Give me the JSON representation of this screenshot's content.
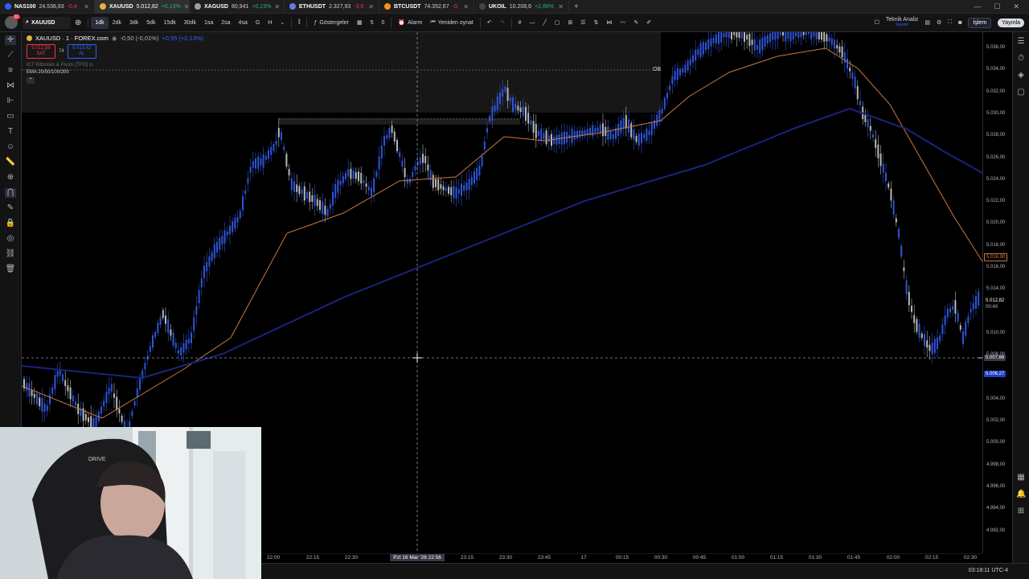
{
  "browser_tabs": [
    {
      "symbol": "NAS100",
      "price": "24.538,83",
      "change": "-0,4",
      "dir": "dn",
      "color": "#2962ff"
    },
    {
      "symbol": "XAUUSD",
      "price": "5.012,82",
      "change": "+0,13%",
      "dir": "up",
      "color": "#e2b23c"
    },
    {
      "symbol": "XAGUSD",
      "price": "80,941",
      "change": "+0,23%",
      "dir": "up",
      "color": "#9aa0a6"
    },
    {
      "symbol": "ETHUSDT",
      "price": "2.327,93",
      "change": "-3,0",
      "dir": "dn",
      "color": "#627eea"
    },
    {
      "symbol": "BTCUSDT",
      "price": "74.352,67",
      "change": "-0,",
      "dir": "dn",
      "color": "#f7931a"
    },
    {
      "symbol": "UKOIL",
      "price": "10.208,6",
      "change": "+2,88%",
      "dir": "up",
      "color": "#444"
    }
  ],
  "toolbar": {
    "symbol": "XAUUSD",
    "intervals": [
      "1dk",
      "2dk",
      "3dk",
      "5dk",
      "15dk",
      "30dk",
      "1sa",
      "2sa",
      "4sa",
      "G",
      "H"
    ],
    "active_interval": "1dk",
    "indicators_label": "Göstergeler",
    "indicator_count_1": "5",
    "indicator_count_2": "0",
    "alarm_label": "Alarm",
    "replay_label": "Yeniden oynat",
    "tech_analysis_label": "Teknik Analiz",
    "tech_analysis_sub": "Kaydet",
    "trade_button": "İşlem",
    "publish_button": "Yayınla"
  },
  "legend": {
    "title": "XAUUSD · 1 · FOREX.com",
    "change": "-0,50 (-0,01%)",
    "change2": "+0,55 (+0,13%)",
    "sell_price": "5.012,88",
    "sell_label": "SAT",
    "spread": "74",
    "buy_price": "5.013,42",
    "buy_label": "AL",
    "indicator1": "ICT Killzones & Pivots [TFO]",
    "indicator2": "EMA 20/50/100/200"
  },
  "price_axis": {
    "labels": [
      "5.036,00",
      "5.034,00",
      "5.032,00",
      "5.030,00",
      "5.028,00",
      "5.026,00",
      "5.024,00",
      "5.022,00",
      "5.020,00",
      "5.018,00",
      "5.016,00",
      "5.014,00",
      "5.010,00",
      "5.008,00",
      "5.004,00",
      "5.002,00",
      "5.000,00",
      "4.998,00",
      "4.996,00",
      "4.994,00",
      "4.992,00"
    ],
    "ema_tag": "5.016,90",
    "current_price": "5.012,82",
    "countdown": "00:49",
    "cursor_price": "5.007,66",
    "low_tag": "5.006,27"
  },
  "time_axis": {
    "labels": [
      "22:00",
      "22:15",
      "22:30",
      "23:15",
      "23:30",
      "23:45",
      "17",
      "00:15",
      "00:30",
      "00:45",
      "01:00",
      "01:15",
      "01:30",
      "01:45",
      "02:00",
      "02:15",
      "02:30"
    ],
    "cursor_label": "Pzt 16 Mar '26   22:56"
  },
  "ob_label": "OB",
  "clock": "03:18:11 UTC-4",
  "webcam_text": "DRIVE",
  "colors": {
    "bull": "#2f54d8",
    "bear": "#b8b8b8",
    "ema20": "#c87941",
    "ema200": "#1a237e",
    "cursor": "#9598a1"
  }
}
